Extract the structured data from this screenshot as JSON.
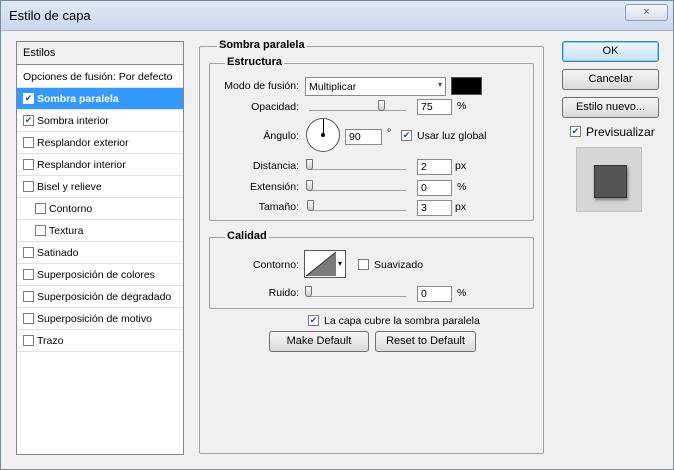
{
  "window": {
    "title": "Estilo de capa",
    "close_symbol": "×"
  },
  "styles_panel": {
    "header": "Estilos",
    "items": [
      {
        "label": "Opciones de fusión: Por defecto",
        "checkbox": false,
        "checked": false,
        "selected": false,
        "indent": false
      },
      {
        "label": "Sombra paralela",
        "checkbox": true,
        "checked": true,
        "selected": true,
        "indent": false
      },
      {
        "label": "Sombra interior",
        "checkbox": true,
        "checked": true,
        "selected": false,
        "indent": false
      },
      {
        "label": "Resplandor exterior",
        "checkbox": true,
        "checked": false,
        "selected": false,
        "indent": false
      },
      {
        "label": "Resplandor interior",
        "checkbox": true,
        "checked": false,
        "selected": false,
        "indent": false
      },
      {
        "label": "Bisel y relieve",
        "checkbox": true,
        "checked": false,
        "selected": false,
        "indent": false
      },
      {
        "label": "Contorno",
        "checkbox": true,
        "checked": false,
        "selected": false,
        "indent": true
      },
      {
        "label": "Textura",
        "checkbox": true,
        "checked": false,
        "selected": false,
        "indent": true
      },
      {
        "label": "Satinado",
        "checkbox": true,
        "checked": false,
        "selected": false,
        "indent": false
      },
      {
        "label": "Superposición de colores",
        "checkbox": true,
        "checked": false,
        "selected": false,
        "indent": false
      },
      {
        "label": "Superposición de degradado",
        "checkbox": true,
        "checked": false,
        "selected": false,
        "indent": false
      },
      {
        "label": "Superposición de motivo",
        "checkbox": true,
        "checked": false,
        "selected": false,
        "indent": false
      },
      {
        "label": "Trazo",
        "checkbox": true,
        "checked": false,
        "selected": false,
        "indent": false
      }
    ]
  },
  "drop_shadow": {
    "title": "Sombra paralela",
    "structure": {
      "title": "Estructura",
      "blend_mode_label": "Modo de fusión:",
      "blend_mode_value": "Multiplicar",
      "shadow_color": "#000000",
      "opacity_label": "Opacidad:",
      "opacity_value": "75",
      "opacity_level": 0.75,
      "opacity_unit": "%",
      "angle_label": "Ángulo:",
      "angle_value": "90",
      "angle_unit": "°",
      "global_light_label": "Usar luz global",
      "global_light_checked": true,
      "distance_label": "Distancia:",
      "distance_value": "2",
      "distance_unit": "px",
      "spread_label": "Extensión:",
      "spread_value": "0",
      "spread_unit": "%",
      "size_label": "Tamaño:",
      "size_value": "3",
      "size_unit": "px"
    },
    "quality": {
      "title": "Calidad",
      "contour_label": "Contorno:",
      "antialias_label": "Suavizado",
      "antialias_checked": false,
      "noise_label": "Ruido:",
      "noise_value": "0",
      "noise_unit": "%"
    },
    "knockout_label": "La capa cubre la sombra paralela",
    "knockout_checked": true,
    "make_default_label": "Make Default",
    "reset_default_label": "Reset to Default"
  },
  "right_panel": {
    "ok_label": "OK",
    "cancel_label": "Cancelar",
    "new_style_label": "Estilo nuevo...",
    "preview_label": "Previsualizar",
    "preview_checked": true
  }
}
